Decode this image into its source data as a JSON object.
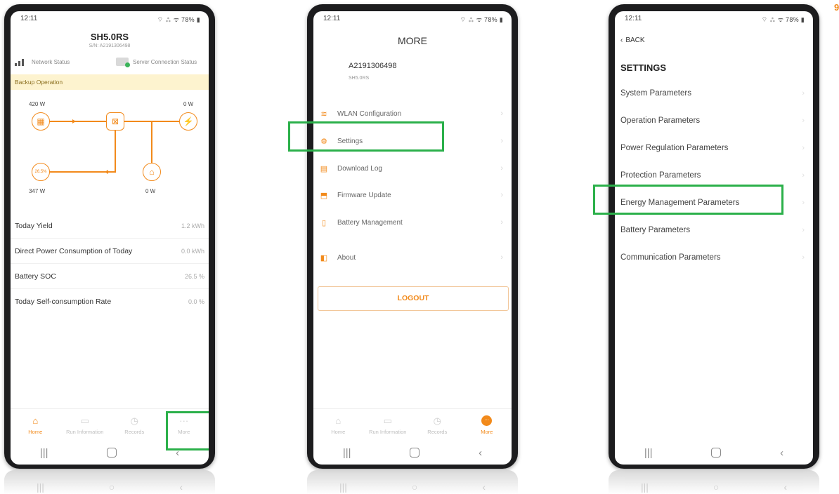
{
  "status_bar": {
    "time": "12:11",
    "signal": "⌔ ⁂ ᯤ 78% ▮"
  },
  "nav": {
    "recents": "|||",
    "back": "‹"
  },
  "tabs": [
    {
      "label": "Home",
      "icon": "home-icon"
    },
    {
      "label": "Run Information",
      "icon": "monitor-icon"
    },
    {
      "label": "Records",
      "icon": "clock-icon"
    },
    {
      "label": "More",
      "icon": "more-icon"
    }
  ],
  "screen1": {
    "title": "SH5.0RS",
    "sn": "S/N: A2191306498",
    "network_status": "Network Status",
    "server_status": "Server Connection Status",
    "banner": "Backup Operation",
    "flow": {
      "pv_power": "420 W",
      "grid_power": "0 W",
      "battery_power": "347 W",
      "load_power": "0 W",
      "battery_soc_badge": "26.5%"
    },
    "more_dots": "···",
    "stats": [
      {
        "label": "Today Yield",
        "value": "1.2 kWh"
      },
      {
        "label": "Direct Power Consumption of Today",
        "value": "0.0 kWh"
      },
      {
        "label": "Battery SOC",
        "value": "26.5 %"
      },
      {
        "label": "Today Self-consumption Rate",
        "value": "0.0 %"
      }
    ]
  },
  "screen2": {
    "title": "MORE",
    "account": "A2191306498",
    "model": "SH5.0RS",
    "menu": [
      {
        "label": "WLAN Configuration",
        "icon": "wlan-icon"
      },
      {
        "label": "Settings",
        "icon": "settings-gear-icon"
      },
      {
        "label": "Download Log",
        "icon": "document-icon"
      },
      {
        "label": "Firmware Update",
        "icon": "firmware-icon"
      },
      {
        "label": "Battery Management",
        "icon": "battery-icon"
      },
      {
        "label": "About",
        "icon": "info-icon"
      }
    ],
    "logout": "LOGOUT",
    "more_dots": "···"
  },
  "screen3": {
    "back": "BACK",
    "title": "SETTINGS",
    "items": [
      "System Parameters",
      "Operation Parameters",
      "Power Regulation Parameters",
      "Protection Parameters",
      "Energy Management Parameters",
      "Battery Parameters",
      "Communication Parameters"
    ]
  },
  "corner_mark": "9",
  "colors": {
    "accent": "#f28a1b",
    "highlight": "#2bb04a",
    "banner": "#fdf3cf"
  }
}
